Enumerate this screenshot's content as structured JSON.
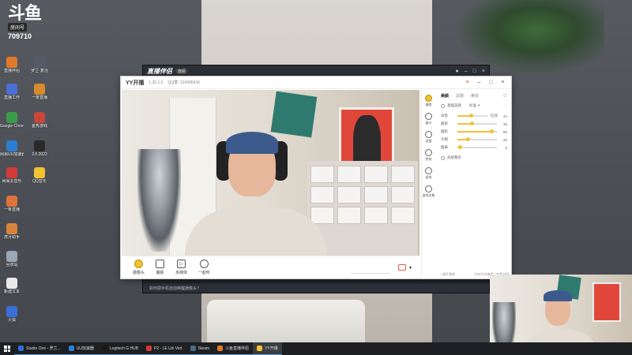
{
  "desktop": {
    "logo": {
      "title": "斗鱼",
      "room_tag": "房间号",
      "room_number": "709710"
    },
    "icons": [
      {
        "label": "此电脑",
        "color": "#4a90d9"
      },
      {
        "label": "直播伴侣",
        "color": "#e07a2a"
      },
      {
        "label": "罗兰·复活",
        "color": "#555b66"
      },
      {
        "label": "直播工作",
        "color": "#4a6fd9"
      },
      {
        "label": "一条直播",
        "color": "#d98a2a"
      },
      {
        "label": "Google Chrome",
        "color": "#3a9c4a"
      },
      {
        "label": "金秀游戏",
        "color": "#c9463a"
      },
      {
        "label": "网易UU加速器",
        "color": "#2d7dd2"
      },
      {
        "label": "2.0.2022",
        "color": "#2a2a2a"
      },
      {
        "label": "网易云音乐",
        "color": "#d23a3a"
      },
      {
        "label": "QQ音乐",
        "color": "#f1c232"
      },
      {
        "label": "一条直播",
        "color": "#e0733a"
      },
      {
        "label": "虎牙助手",
        "color": "#d9843a"
      },
      {
        "label": "腾讯QQ",
        "color": "#222"
      },
      {
        "label": "回收站",
        "color": "#9aa7b4"
      },
      {
        "label": "新建文本",
        "color": "#e9e9e9"
      },
      {
        "label": "火狐",
        "color": "#3a6fd9"
      }
    ]
  },
  "companion_window": {
    "title": "直播伴侣",
    "badge": "旗舰",
    "bottom_text": "如何把手机自动唤醒摄像头?"
  },
  "yy_window": {
    "app_name": "YY开播",
    "version": "1.35.1.2",
    "qq_label": "QQ群: 124396416",
    "controls": [
      {
        "label": "摄像头",
        "icon": "camera-icon"
      },
      {
        "label": "捕获",
        "icon": "capture-icon"
      },
      {
        "label": "多媒体",
        "icon": "media-icon"
      },
      {
        "label": "一起听",
        "icon": "listen-icon"
      }
    ],
    "side_nav": [
      {
        "label": "美颜",
        "icon": "beauty-icon"
      },
      {
        "label": "窗口",
        "icon": "window-icon"
      },
      {
        "label": "滤镜",
        "icon": "filter-icon"
      },
      {
        "label": "特效",
        "icon": "effect-icon"
      },
      {
        "label": "虚拟",
        "icon": "avatar-icon"
      },
      {
        "label": "虚拟形象",
        "icon": "virtual-icon"
      }
    ],
    "panel": {
      "tabs": [
        "美颜",
        "滤镜",
        "美妆"
      ],
      "one_click_label": "基础美颜",
      "preset_label": "标准",
      "sliders": [
        {
          "label": "白皙",
          "value": 44,
          "extra": "红润"
        },
        {
          "label": "磨皮",
          "value": 35
        },
        {
          "label": "瘦脸",
          "value": 85
        },
        {
          "label": "大眼",
          "value": 25
        },
        {
          "label": "瘦鼻",
          "value": 5
        }
      ],
      "advanced_label": "高级整形",
      "footer_left": "一键开美颜",
      "footer_right": "如何开启美颜? 查看说明"
    }
  },
  "taskbar": {
    "items": [
      {
        "label": "Studio One - 罗兰...",
        "color": "#2a6fd9"
      },
      {
        "label": "UU加速器",
        "color": "#2d7dd2"
      },
      {
        "label": "Logitech G HUB",
        "color": "#1a1a1a"
      },
      {
        "label": "P2 - LE Uzi Vert",
        "color": "#d23a3a"
      },
      {
        "label": "Steam",
        "color": "#4a6a8a"
      },
      {
        "label": "斗鱼直播伴侣",
        "color": "#e07a2a"
      },
      {
        "label": "YY开播",
        "color": "#f1c232"
      }
    ]
  }
}
